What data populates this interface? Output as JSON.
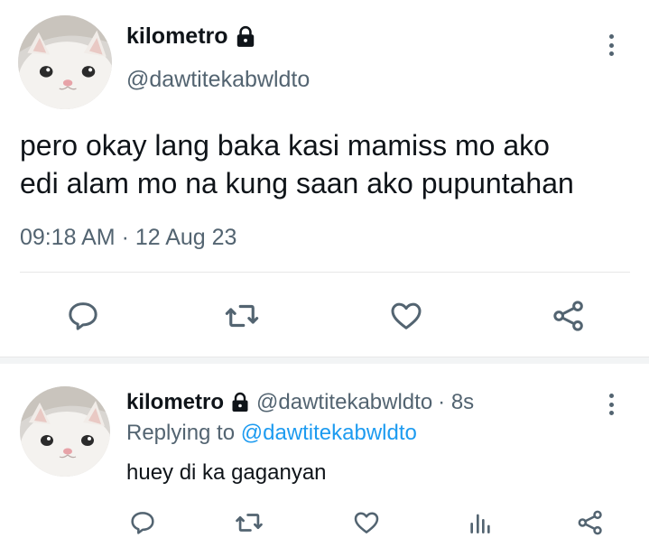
{
  "main_tweet": {
    "display_name": "kilometro",
    "handle": "@dawtitekabwldto",
    "text_lines": [
      "pero okay lang baka kasi mamiss mo ako",
      "edi alam mo na kung saan ako pupuntahan"
    ],
    "timestamp": "09:18 AM · 12 Aug 23",
    "actions": [
      "reply-icon",
      "retweet-icon",
      "like-icon",
      "share-icon"
    ]
  },
  "reply": {
    "display_name": "kilometro",
    "handle": "@dawtitekabwldto",
    "time_ago": "· 8s",
    "replying_prefix": "Replying to ",
    "replying_mention": "@dawtitekabwldto",
    "text": "huey di ka gaganyan",
    "actions": [
      "reply-icon",
      "retweet-icon",
      "like-icon",
      "analytics-icon",
      "share-icon"
    ]
  },
  "colors": {
    "text_primary": "#0f1419",
    "text_secondary": "#536471",
    "accent": "#1d9bf0",
    "divider": "#e7e7e7"
  }
}
